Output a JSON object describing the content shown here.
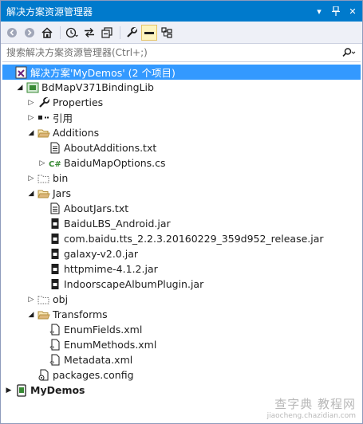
{
  "window": {
    "title": "解决方案资源管理器",
    "controls": [
      "pin-dropdown-icon",
      "auto-hide-pin-icon",
      "close-icon"
    ]
  },
  "toolbar": {
    "buttons": [
      "back-icon",
      "forward-icon",
      "home-icon",
      "history-icon",
      "sync-icon",
      "collapse-all-icon",
      "properties-wrench-icon",
      "show-all-files-icon",
      "class-view-icon"
    ]
  },
  "search": {
    "placeholder": "搜索解决方案资源管理器(Ctrl+;)"
  },
  "tree": {
    "solution": "解决方案'MyDemos' (2 个项目)",
    "project": "BdMapV371BindingLib",
    "properties": "Properties",
    "references": "引用",
    "additions": "Additions",
    "about_additions": "AboutAdditions.txt",
    "baidu_map_options": "BaiduMapOptions.cs",
    "bin": "bin",
    "jars": "Jars",
    "about_jars": "AboutJars.txt",
    "jar1": "BaiduLBS_Android.jar",
    "jar2": "com.baidu.tts_2.2.3.20160229_359d952_release.jar",
    "jar3": "galaxy-v2.0.jar",
    "jar4": "httpmime-4.1.2.jar",
    "jar5": "IndoorscapeAlbumPlugin.jar",
    "obj": "obj",
    "transforms": "Transforms",
    "enum_fields": "EnumFields.xml",
    "enum_methods": "EnumMethods.xml",
    "metadata": "Metadata.xml",
    "packages": "packages.config",
    "my_demos": "MyDemos"
  },
  "watermark": {
    "line1": "查字典 教程网",
    "line2": "jiaocheng.chazidian.com"
  },
  "colors": {
    "accent": "#007acc",
    "selection": "#3399ff",
    "toolbar_bg": "#eef0f7",
    "folder": "#dcb67a",
    "csharp": "#68217a"
  }
}
